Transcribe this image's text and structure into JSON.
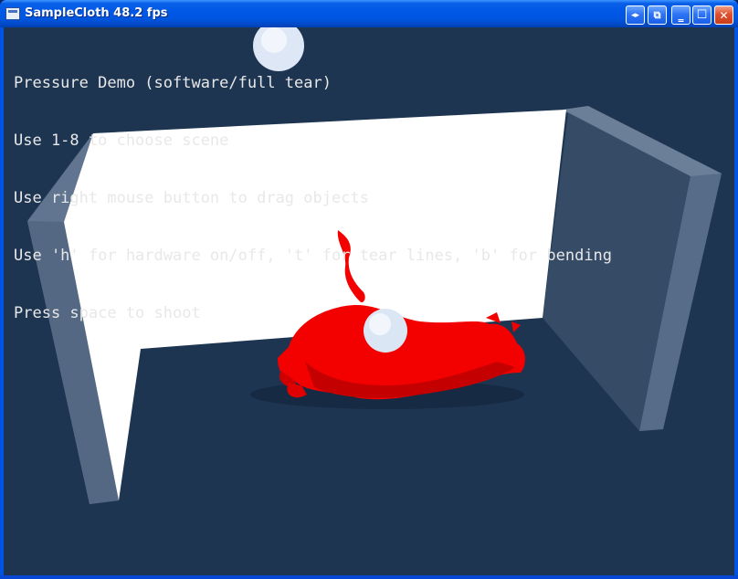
{
  "window": {
    "title": "SampleCloth 48.2 fps",
    "buttons": {
      "extra1": "◂▸",
      "extra2": "⧉",
      "minimize": "‗",
      "maximize": "☐",
      "close": "✕"
    }
  },
  "overlay": {
    "lines": [
      "Pressure Demo (software/full tear)",
      "Use 1-8 to choose scene",
      "Use right mouse button to drag objects",
      "Use 'h' for hardware on/off, 't' for tear lines, 'b' for bending",
      "Press space to shoot"
    ]
  },
  "scene": {
    "colors": {
      "background": "#1e3552",
      "wall_front": "#ffffff",
      "wall_side": "#6b7f98",
      "cloth": "#ff0000",
      "sphere": "#dbe6f5"
    }
  }
}
